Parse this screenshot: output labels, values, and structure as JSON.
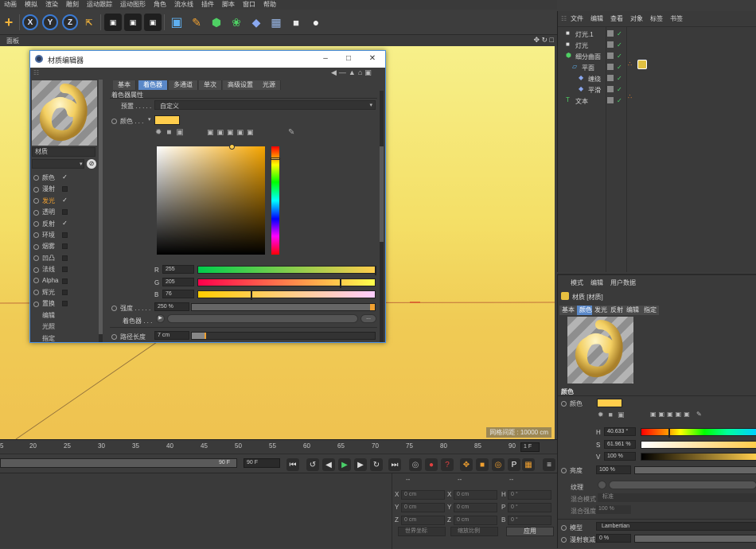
{
  "menubar": [
    "动画",
    "模拟",
    "渲染",
    "雕刻",
    "运动跟踪",
    "运动图形",
    "角色",
    "流水线",
    "插件",
    "脚本",
    "窗口",
    "帮助"
  ],
  "toolbar": {
    "x": "X",
    "y": "Y",
    "z": "Z"
  },
  "viewport": {
    "panel_label": "面板",
    "status": "网格间距 : 10000 cm"
  },
  "timeline": {
    "ticks": [
      "5",
      "20",
      "25",
      "30",
      "35",
      "40",
      "45",
      "50",
      "55",
      "60",
      "65",
      "70",
      "75",
      "80",
      "85",
      "90"
    ],
    "current_frame": "1 F"
  },
  "playbar": {
    "end_frame": "90 F",
    "end_frame2": "90 F"
  },
  "coords": {
    "headers": [
      "--",
      "--",
      "--"
    ],
    "x": "X",
    "y": "Y",
    "z": "Z",
    "h": "H",
    "p": "P",
    "b": "B",
    "pos_value": "0 cm",
    "angle_value": "0 °",
    "world": "世界坐标",
    "scale": "缩放比例",
    "apply": "应用"
  },
  "object_manager": {
    "menu": [
      "文件",
      "编辑",
      "查看",
      "对象",
      "标签",
      "书签"
    ],
    "items": [
      {
        "name": "灯光.1"
      },
      {
        "name": "灯光"
      },
      {
        "name": "细分曲面"
      },
      {
        "name": "平面"
      },
      {
        "name": "缠绕"
      },
      {
        "name": "平滑"
      },
      {
        "name": "文本"
      }
    ]
  },
  "attributes": {
    "menu": [
      "模式",
      "编辑",
      "用户数据"
    ],
    "title": "材质 [材质]",
    "tabs": [
      "基本",
      "颜色",
      "发光",
      "反射",
      "编辑",
      "指定"
    ],
    "active_tab": "颜色",
    "section": "颜色",
    "color_label": "颜色",
    "h_label": "H",
    "h_value": "40.633 °",
    "s_label": "S",
    "s_value": "61.961 %",
    "v_label": "V",
    "v_value": "100 %",
    "brightness_label": "亮度",
    "brightness_value": "100 %",
    "texture_label": "纹理",
    "blend_mode_label": "混合模式",
    "blend_mode_value": "标准",
    "blend_strength_label": "混合强度",
    "blend_strength_value": "100 %",
    "model_label": "模型",
    "model_value": "Lambertian",
    "diffuse_label": "漫射衰减",
    "diffuse_value": "0 %",
    "swatch_color": "#ffcd4c"
  },
  "material_editor": {
    "title": "材质编辑器",
    "material_name": "材质",
    "channels": [
      {
        "label": "颜色",
        "checked": true
      },
      {
        "label": "漫射",
        "checked": false
      },
      {
        "label": "发光",
        "checked": true
      },
      {
        "label": "透明",
        "checked": false
      },
      {
        "label": "反射",
        "checked": true
      },
      {
        "label": "环境",
        "checked": false
      },
      {
        "label": "烟雾",
        "checked": false
      },
      {
        "label": "凹凸",
        "checked": false
      },
      {
        "label": "法线",
        "checked": false
      },
      {
        "label": "Alpha",
        "checked": false
      },
      {
        "label": "辉光",
        "checked": false
      },
      {
        "label": "置换",
        "checked": false
      },
      {
        "label": "编辑",
        "checked": null
      },
      {
        "label": "光照",
        "checked": null
      },
      {
        "label": "指定",
        "checked": null
      }
    ],
    "active_channel": "发光",
    "tabs": [
      "基本",
      "着色器",
      "多通道",
      "单次",
      "高级设置",
      "光源"
    ],
    "active_tab": "着色器",
    "section_title": "着色器属性",
    "preset_label": "预置 . . . . .",
    "preset_value": "自定义",
    "color_label": "颜色 . . .",
    "r_label": "R",
    "r_value": "255",
    "g_label": "G",
    "g_value": "205",
    "b_label": "B",
    "b_value": "76",
    "rgb": {
      "r": 255,
      "g": 205,
      "b": 76
    },
    "intensity_label": "强度 . . . . .",
    "intensity_value": "250 %",
    "shader_label": "着色器 . . .",
    "shader_button": "...",
    "path_label": "路径长度",
    "path_value": "7 cm",
    "swatch_color": "#ffcd4c"
  }
}
